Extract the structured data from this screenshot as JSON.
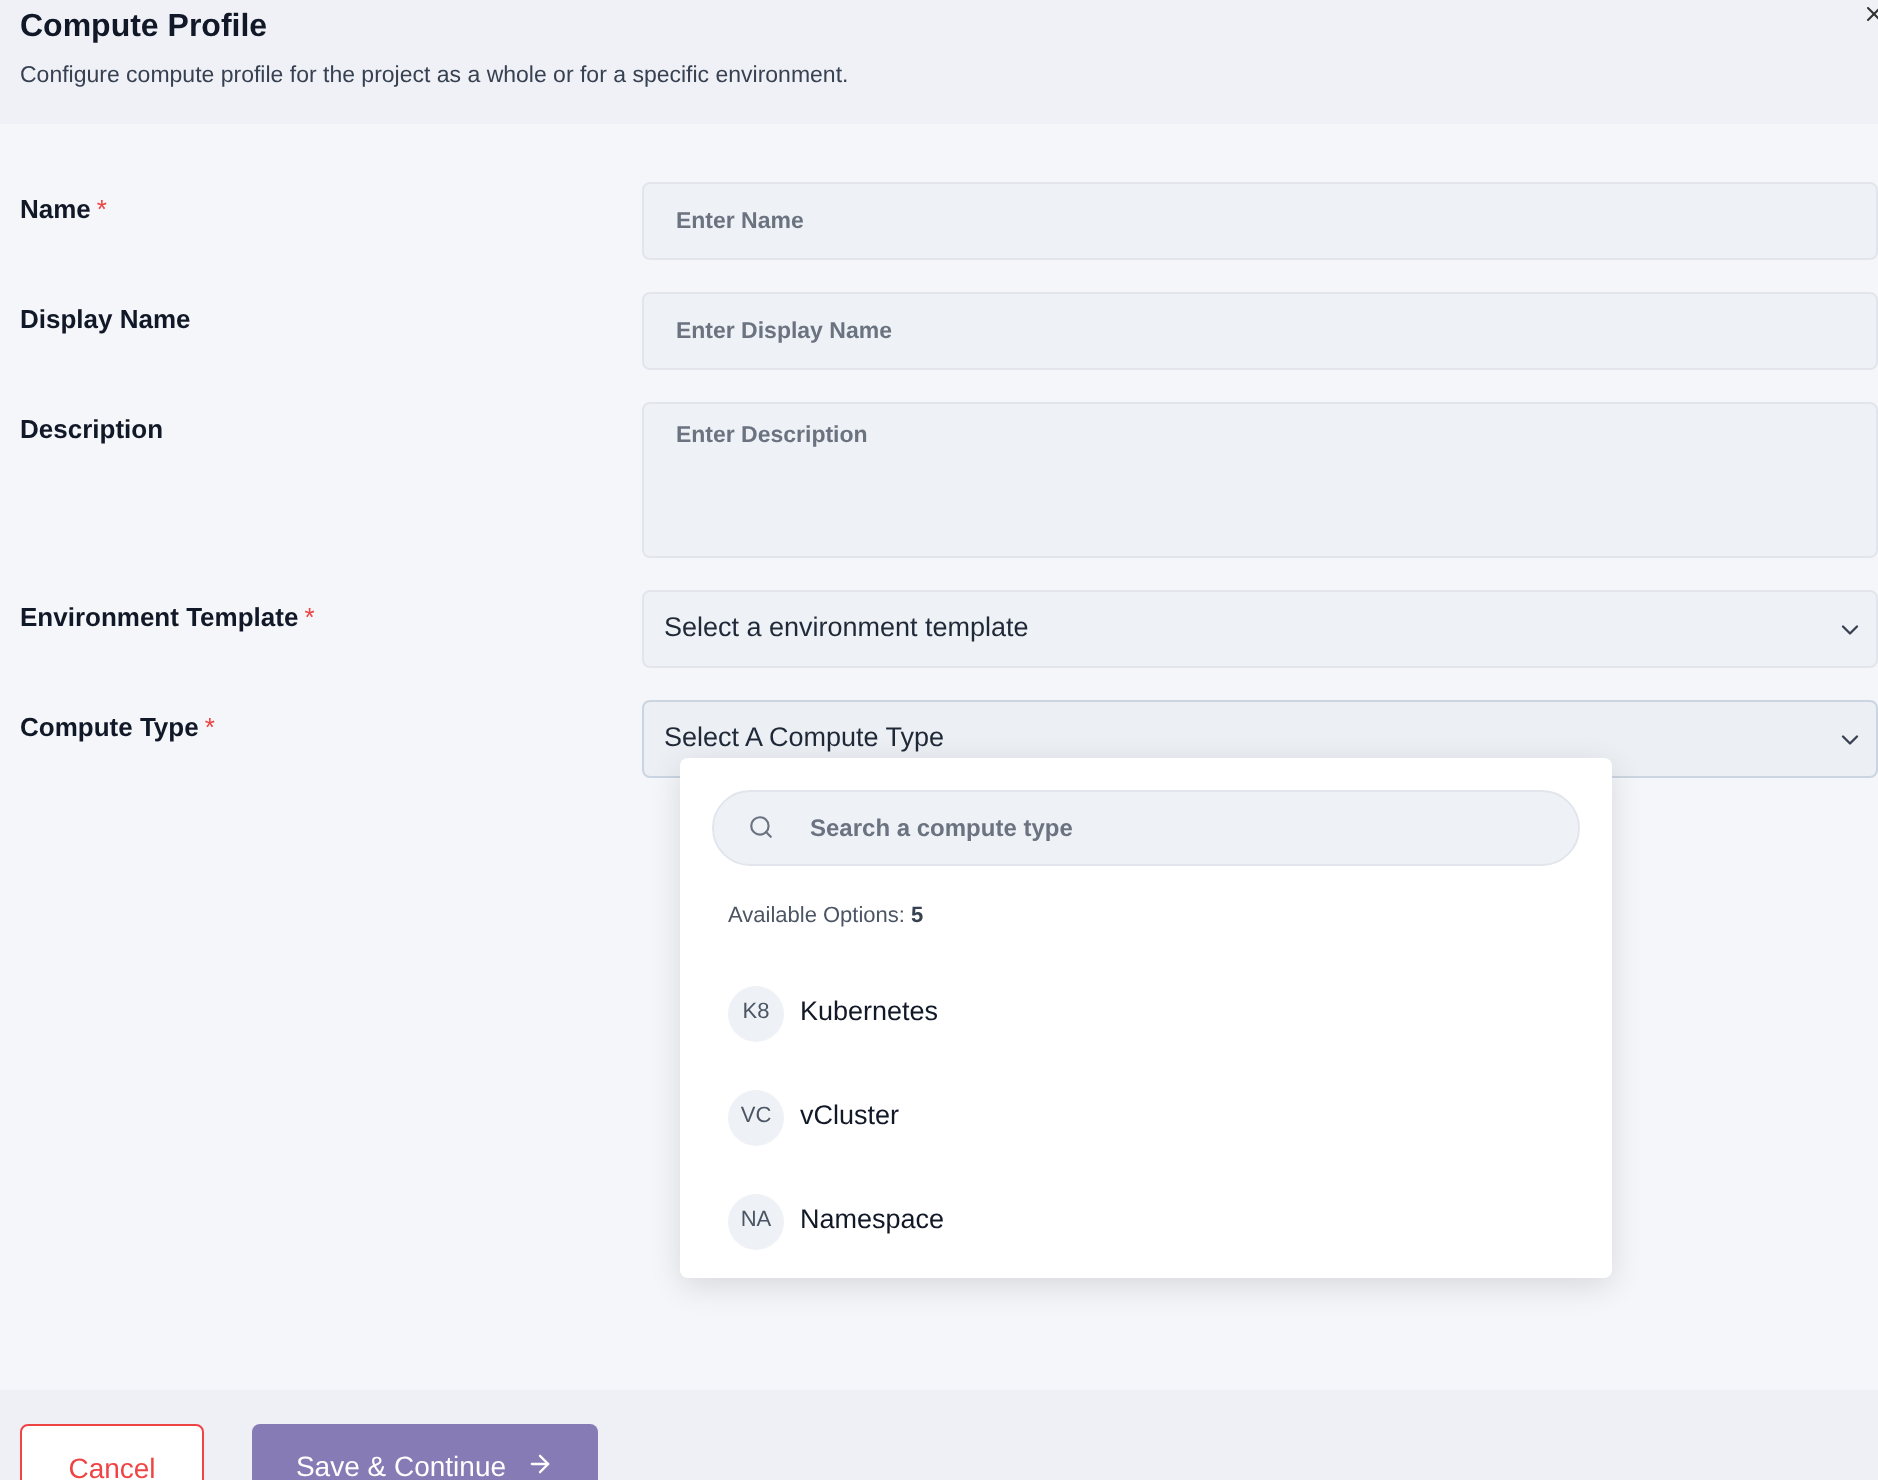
{
  "header": {
    "title": "Compute Profile",
    "subtitle": "Configure compute profile for the project as a whole or for a specific environment.",
    "required_mark": "*"
  },
  "fields": [
    {
      "kind": "text",
      "label": "Name",
      "required": true,
      "placeholder": "Enter Name"
    },
    {
      "kind": "text",
      "label": "Display Name",
      "required": false,
      "placeholder": "Enter Display Name"
    },
    {
      "kind": "textarea",
      "label": "Description",
      "required": false,
      "placeholder": "Enter Description"
    },
    {
      "kind": "select",
      "label": "Environment Template",
      "required": true,
      "value": "Select a environment template"
    },
    {
      "kind": "select",
      "label": "Compute Type",
      "required": true,
      "value": "Select A Compute Type",
      "expanded": true
    }
  ],
  "dropdown": {
    "search_placeholder": "Search a compute type",
    "count_label": "Available Options:",
    "count": "5",
    "options": [
      {
        "abbr": "K8",
        "label": "Kubernetes"
      },
      {
        "abbr": "VC",
        "label": "vCluster"
      },
      {
        "abbr": "NA",
        "label": "Namespace"
      }
    ]
  },
  "footer": {
    "cancel": "Cancel",
    "save": "Save & Continue"
  }
}
